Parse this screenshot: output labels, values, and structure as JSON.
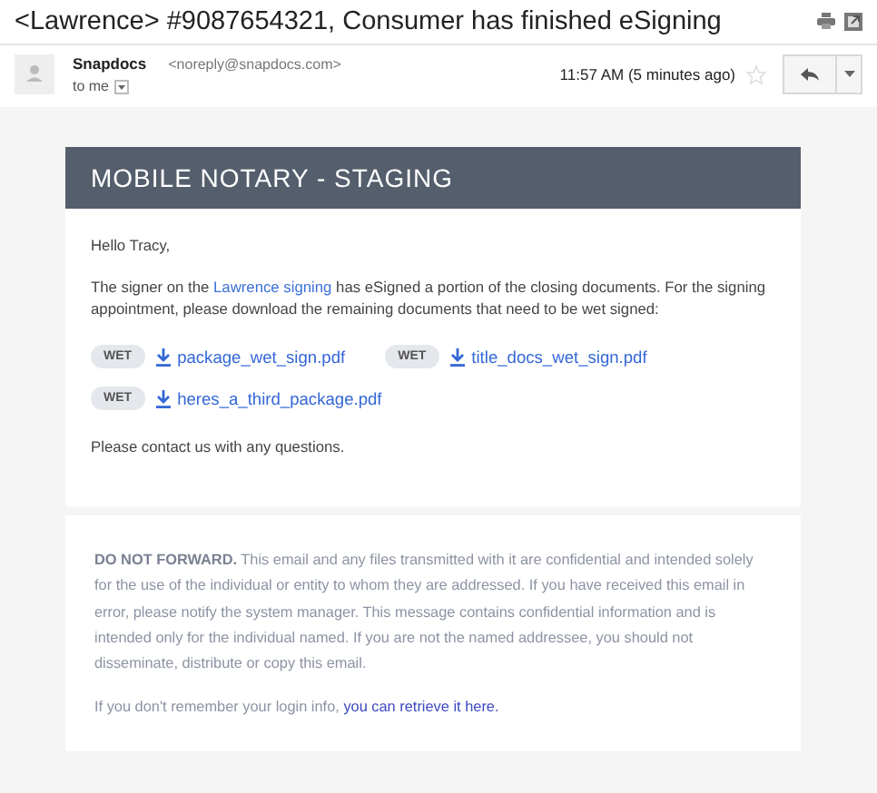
{
  "email": {
    "subject": "<Lawrence> #9087654321, Consumer has finished eSigning",
    "sender": {
      "name": "Snapdocs",
      "address": "<noreply@snapdocs.com>"
    },
    "recipient": "to me",
    "time": "11:57 AM (5 minutes ago)",
    "starred": false
  },
  "message": {
    "banner": "MOBILE NOTARY - STAGING",
    "greeting": "Hello Tracy,",
    "intro": {
      "before": "The signer on the ",
      "link": "Lawrence signing",
      "after": " has eSigned a portion of the closing documents. For the signing appointment, please download the remaining documents that need to be wet signed:"
    },
    "attachments": [
      {
        "tag": "WET",
        "file": "package_wet_sign.pdf"
      },
      {
        "tag": "WET",
        "file": "title_docs_wet_sign.pdf"
      },
      {
        "tag": "WET",
        "file": "heres_a_third_package.pdf"
      }
    ],
    "closing": "Please contact us with any questions.",
    "disclaimer": {
      "lead": "DO NOT FORWARD.",
      "text": " This email and any files transmitted with it are confidential and intended solely for the use of the individual or entity to whom they are addressed. If you have received this email in error, please notify the system manager. This message contains confidential information and is intended only for the individual named. If you are not the named addressee, you should not disseminate, distribute or copy this email."
    },
    "login": {
      "before": "If you don't remember your login info, ",
      "link": "you can retrieve it here."
    }
  }
}
